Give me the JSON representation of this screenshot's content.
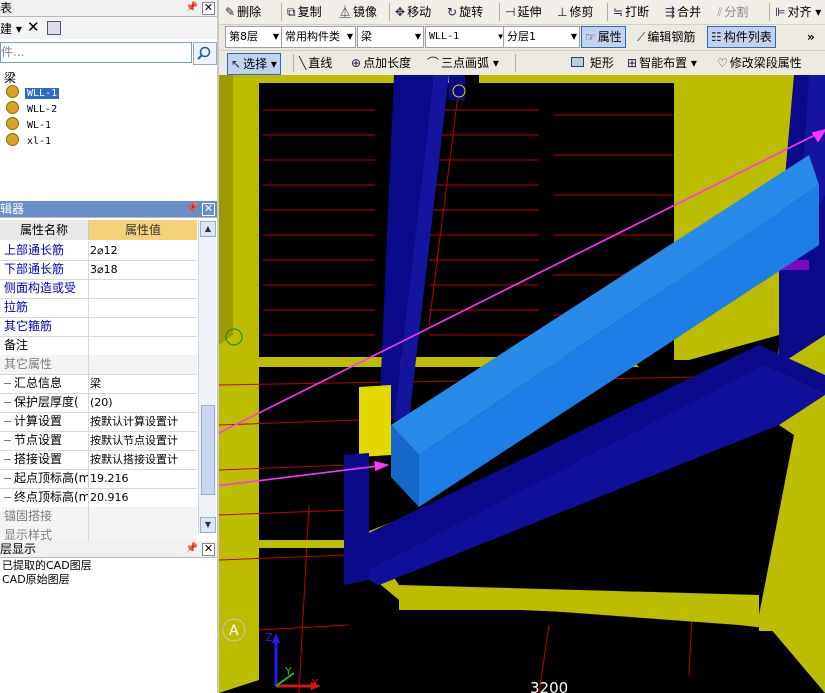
{
  "left_panel": {
    "title": "表",
    "toolbar_new": "建",
    "search_placeholder": "件...",
    "tree_root": "梁",
    "tree_items": [
      "WLL-1",
      "WLL-2",
      "WL-1",
      "xl-1"
    ],
    "props_title": "辑器",
    "header_name": "属性名称",
    "header_value": "属性值",
    "rows": [
      {
        "name": "上部通长筋",
        "value": "2⌀12",
        "color": "#0000c0"
      },
      {
        "name": "下部通长筋",
        "value": "3⌀18",
        "color": "#0000c0"
      },
      {
        "name": "侧面构造或受",
        "value": "",
        "color": "#0000c0"
      },
      {
        "name": "拉筋",
        "value": "",
        "color": "#0000c0"
      },
      {
        "name": "其它箍筋",
        "value": "",
        "color": "#0000c0"
      },
      {
        "name": "备注",
        "value": "",
        "color": "#000000"
      },
      {
        "name": "其它属性",
        "value": "",
        "color": "#7f7f7f"
      },
      {
        "name": "汇总信息",
        "value": "梁",
        "color": "#000000"
      },
      {
        "name": "保护层厚度(",
        "value": "(20)",
        "color": "#000000"
      },
      {
        "name": "计算设置",
        "value": "按默认计算设置计",
        "color": "#000000"
      },
      {
        "name": "节点设置",
        "value": "按默认节点设置计",
        "color": "#000000"
      },
      {
        "name": "搭接设置",
        "value": "按默认搭接设置计",
        "color": "#000000"
      },
      {
        "name": "起点顶标高(m",
        "value": "19.216",
        "color": "#000000"
      },
      {
        "name": "终点顶标高(m",
        "value": "20.916",
        "color": "#000000"
      },
      {
        "name": "锚固搭接",
        "value": "",
        "color": "#7f7f7f"
      },
      {
        "name": "显示样式",
        "value": "",
        "color": "#7f7f7f"
      }
    ],
    "layers_title": "层显示",
    "layer_items": [
      "已提取的CAD图层",
      "CAD原始图层"
    ]
  },
  "toolbar1": {
    "delete": "删除",
    "copy": "复制",
    "mirror": "镜像",
    "move": "移动",
    "rotate": "旋转",
    "extend": "延伸",
    "trim": "修剪",
    "break": "打断",
    "merge": "合并",
    "split": "分割",
    "align": "对齐"
  },
  "toolbar2": {
    "floor": "第8层",
    "category": "常用构件类",
    "type": "梁",
    "component": "WLL-1",
    "sublayer": "分层1",
    "properties": "属性",
    "edit_rebar": "编辑钢筋",
    "component_list": "构件列表"
  },
  "toolbar3": {
    "select": "选择",
    "line": "直线",
    "point_length": "点加长度",
    "arc": "三点画弧",
    "rectangle": "矩形",
    "smart_layout": "智能布置",
    "modify_segment": "修改梁段属性"
  },
  "viewport": {
    "axis_label": "A",
    "dimension": "3200",
    "axes": {
      "x": "X",
      "y": "Y",
      "z": "Z"
    },
    "colors": {
      "background": "#000000",
      "slab": "#bdbd00",
      "beam": "#0a0a8a",
      "selected_beam": "#1e7ee6",
      "grid": "#c00000",
      "arrow": "#ff33ff"
    }
  }
}
